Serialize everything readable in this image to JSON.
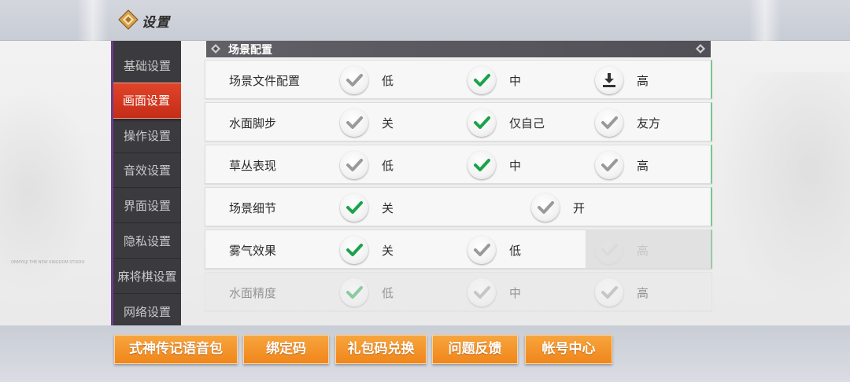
{
  "header": {
    "title": "设置"
  },
  "sidebar": {
    "items": [
      {
        "label": "基础设置",
        "active": false
      },
      {
        "label": "画面设置",
        "active": true
      },
      {
        "label": "操作设置",
        "active": false
      },
      {
        "label": "音效设置",
        "active": false
      },
      {
        "label": "界面设置",
        "active": false
      },
      {
        "label": "隐私设置",
        "active": false
      },
      {
        "label": "麻将棋设置",
        "active": false
      },
      {
        "label": "网络设置",
        "active": false
      }
    ]
  },
  "section": {
    "title": "场景配置"
  },
  "settings": [
    {
      "label": "场景文件配置",
      "options": [
        {
          "text": "低",
          "state": "off",
          "icon": "check-icon"
        },
        {
          "text": "中",
          "state": "on",
          "icon": "check-icon"
        },
        {
          "text": "高",
          "state": "off",
          "icon": "download-icon"
        }
      ]
    },
    {
      "label": "水面脚步",
      "options": [
        {
          "text": "关",
          "state": "off",
          "icon": "check-icon"
        },
        {
          "text": "仅自己",
          "state": "on",
          "icon": "check-icon"
        },
        {
          "text": "友方",
          "state": "off",
          "icon": "check-icon"
        }
      ]
    },
    {
      "label": "草丛表现",
      "options": [
        {
          "text": "低",
          "state": "off",
          "icon": "check-icon"
        },
        {
          "text": "中",
          "state": "on",
          "icon": "check-icon"
        },
        {
          "text": "高",
          "state": "off",
          "icon": "check-icon"
        }
      ]
    },
    {
      "label": "场景细节",
      "options": [
        {
          "text": "关",
          "state": "on",
          "icon": "check-icon"
        },
        {
          "text": "开",
          "state": "off",
          "icon": "check-icon"
        }
      ]
    },
    {
      "label": "雾气效果",
      "options": [
        {
          "text": "关",
          "state": "on",
          "icon": "check-icon"
        },
        {
          "text": "低",
          "state": "off",
          "icon": "check-icon"
        },
        {
          "text": "高",
          "state": "disabled",
          "icon": "check-icon"
        }
      ]
    },
    {
      "label": "水面精度",
      "options": [
        {
          "text": "低",
          "state": "on",
          "icon": "check-icon"
        },
        {
          "text": "中",
          "state": "off",
          "icon": "check-icon"
        },
        {
          "text": "高",
          "state": "off",
          "icon": "check-icon"
        }
      ]
    }
  ],
  "footer": {
    "buttons": [
      {
        "label": "式神传记语音包"
      },
      {
        "label": "绑定码"
      },
      {
        "label": "礼包码兑换"
      },
      {
        "label": "问题反馈"
      },
      {
        "label": "帐号中心"
      }
    ]
  },
  "caption": "ONMYOJI THE NEW KINGDOM STUDIO",
  "colors": {
    "accent": "#e0442a",
    "check_on": "#1aa34a",
    "check_off": "#9a9a9a",
    "button": "#f0861b"
  }
}
